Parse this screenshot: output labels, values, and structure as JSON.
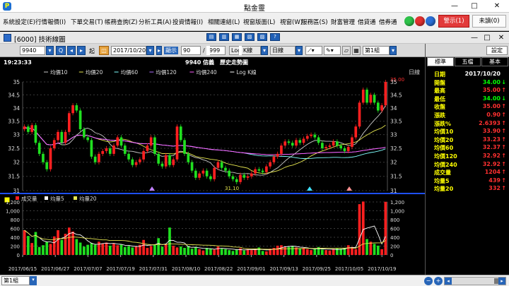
{
  "app": {
    "title": "點金靈",
    "icon_label": "P"
  },
  "window_controls": {
    "minimize": "—",
    "maximize": "□",
    "close": "✕"
  },
  "menu": [
    {
      "label": "系統設定(E)",
      "icon": "gear-icon"
    },
    {
      "label": "行情報價(I)",
      "icon": "quote-icon"
    },
    {
      "label": "下單交易(T)",
      "icon": "order-icon"
    },
    {
      "label": "帳務查詢(Z)",
      "icon": "account-icon"
    },
    {
      "label": "分析工具(A)",
      "icon": "analysis-icon"
    },
    {
      "label": "投資情報(I)",
      "icon": "news-icon"
    },
    {
      "label": "相關連結(L)",
      "icon": "link-icon"
    },
    {
      "label": "視窗版面(L)",
      "icon": "layout-icon"
    },
    {
      "label": "視窗(W)",
      "icon": "window-icon"
    },
    {
      "label": "服務區(S)",
      "icon": "service-icon"
    },
    {
      "label": "財富管理",
      "icon": "wealth-icon"
    },
    {
      "label": "借貸通",
      "icon": "loan-icon"
    },
    {
      "label": "借券通",
      "icon": "lending-icon"
    }
  ],
  "menu_right": {
    "alert": "警示(1)",
    "unread": "未讀(0)"
  },
  "chart_window": {
    "title": "[6000] 技術線圖"
  },
  "toolbar": {
    "symbol": "9940",
    "start_label": "起",
    "date": "2017/10/20",
    "display_label": "顯示",
    "display_count": "90",
    "total": "999",
    "scale": "Log K線",
    "period": "日線",
    "group": "第1組"
  },
  "sidepanel": {
    "tabs": [
      "標準",
      "五檔",
      "基本"
    ],
    "settings_label": "設定",
    "rows": [
      {
        "k": "日期",
        "v": "2017/10/20",
        "a": "",
        "color": "#ffffff"
      },
      {
        "k": "開盤",
        "v": "34.00",
        "a": "↓",
        "color": "#00ff00"
      },
      {
        "k": "最高",
        "v": "35.00",
        "a": "↑",
        "color": "#ff3030"
      },
      {
        "k": "最低",
        "v": "34.00",
        "a": "↓",
        "color": "#00ff00"
      },
      {
        "k": "收盤",
        "v": "35.00",
        "a": "↑",
        "color": "#ff3030"
      },
      {
        "k": "漲跌",
        "v": "0.90",
        "a": "↑",
        "color": "#ff3030"
      },
      {
        "k": "漲跌%",
        "v": "2.6393",
        "a": "↑",
        "color": "#ff3030"
      },
      {
        "k": "均價10",
        "v": "33.90",
        "a": "↑",
        "color": "#ff3030"
      },
      {
        "k": "均價20",
        "v": "33.23",
        "a": "↑",
        "color": "#ff3030"
      },
      {
        "k": "均價60",
        "v": "32.37",
        "a": "↑",
        "color": "#ff3030"
      },
      {
        "k": "均價120",
        "v": "32.92",
        "a": "↑",
        "color": "#ff3030"
      },
      {
        "k": "均價240",
        "v": "32.92",
        "a": "↑",
        "color": "#ff3030"
      },
      {
        "k": "成交量",
        "v": "1204",
        "a": "↑",
        "color": "#ff3030"
      },
      {
        "k": "均量5",
        "v": "439",
        "a": "↑",
        "color": "#ff3030"
      },
      {
        "k": "均量20",
        "v": "332",
        "a": "↑",
        "color": "#ff3030"
      }
    ]
  },
  "status": {
    "group": "第1組"
  },
  "chart_data": {
    "type": "candlestick",
    "time": "19:23:33",
    "title": "9940 信義　歷史走勢圖",
    "legend": [
      "均價10",
      "均價20",
      "均價60",
      "均價120",
      "均價240",
      "Log K線"
    ],
    "legend_colors": [
      "#c8c8c8",
      "#e6e650",
      "#80ffff",
      "#b070ff",
      "#ff60ff",
      "#ffffff"
    ],
    "period_label": "日線",
    "ylim": [
      31,
      35
    ],
    "y_ticks": [
      31,
      31.5,
      32,
      32.5,
      33,
      33.5,
      34,
      34.5,
      35
    ],
    "price_max_label": "35.00",
    "price_min_label": "31.10",
    "x_labels": [
      "2017/06/15",
      "2017/06/27",
      "2017/07/07",
      "2017/07/19",
      "2017/07/31",
      "2017/08/10",
      "2017/08/22",
      "2017/09/01",
      "2017/09/13",
      "2017/09/25",
      "2017/10/05",
      "2017/10/19"
    ],
    "closes": [
      33.3,
      33.1,
      33.35,
      32.7,
      32.3,
      32.0,
      31.75,
      32.5,
      32.8,
      33.1,
      32.7,
      33.1,
      33.8,
      34.1,
      33.9,
      33.2,
      32.9,
      32.8,
      32.2,
      32.0,
      32.3,
      32.4,
      32.5,
      32.3,
      32.6,
      32.9,
      32.6,
      32.3,
      32.1,
      31.9,
      32.0,
      32.1,
      32.4,
      32.6,
      32.9,
      32.3,
      31.95,
      31.85,
      32.25,
      31.9,
      32.1,
      33.3,
      32.8,
      32.3,
      32.0,
      31.7,
      31.45,
      31.6,
      31.7,
      31.5,
      31.4,
      31.8,
      32.0,
      31.8,
      31.7,
      31.5,
      31.4,
      31.3,
      31.55,
      31.45,
      31.5,
      31.6,
      31.75,
      31.7,
      31.65,
      31.85,
      32.0,
      32.2,
      32.3,
      32.6,
      32.75,
      32.7,
      32.6,
      32.8,
      32.7,
      32.85,
      32.95,
      33.0,
      32.9,
      32.7,
      32.5,
      32.55,
      32.6,
      32.75,
      32.6,
      32.5,
      32.4,
      32.55,
      32.9,
      33.3,
      34.2,
      34.7,
      34.2,
      34.5,
      34.2,
      33.9,
      34.1,
      35.0
    ],
    "volume": {
      "legend": [
        "成交量",
        "均量5",
        "均量20"
      ],
      "ylim": [
        0,
        1200
      ],
      "y_ticks": [
        0,
        200,
        400,
        600,
        800,
        1000,
        1200
      ],
      "values": [
        560,
        430,
        270,
        520,
        180,
        220,
        300,
        250,
        420,
        560,
        340,
        480,
        620,
        530,
        360,
        280,
        190,
        230,
        270,
        230,
        300,
        260,
        280,
        210,
        260,
        220,
        230,
        180,
        200,
        170,
        190,
        230,
        340,
        160,
        200,
        230,
        380,
        190,
        240,
        620,
        210,
        170,
        190,
        160,
        200,
        140,
        180,
        130,
        100,
        160,
        140,
        120,
        190,
        140,
        130,
        110,
        90,
        120,
        150,
        100,
        130,
        110,
        120,
        170,
        90,
        80,
        140,
        160,
        210,
        220,
        190,
        180,
        200,
        170,
        150,
        160,
        130,
        110,
        140,
        180,
        120,
        110,
        100,
        130,
        150,
        140,
        160,
        220,
        180,
        130,
        1150,
        1210,
        360,
        300,
        250,
        210,
        130,
        1204
      ]
    }
  }
}
